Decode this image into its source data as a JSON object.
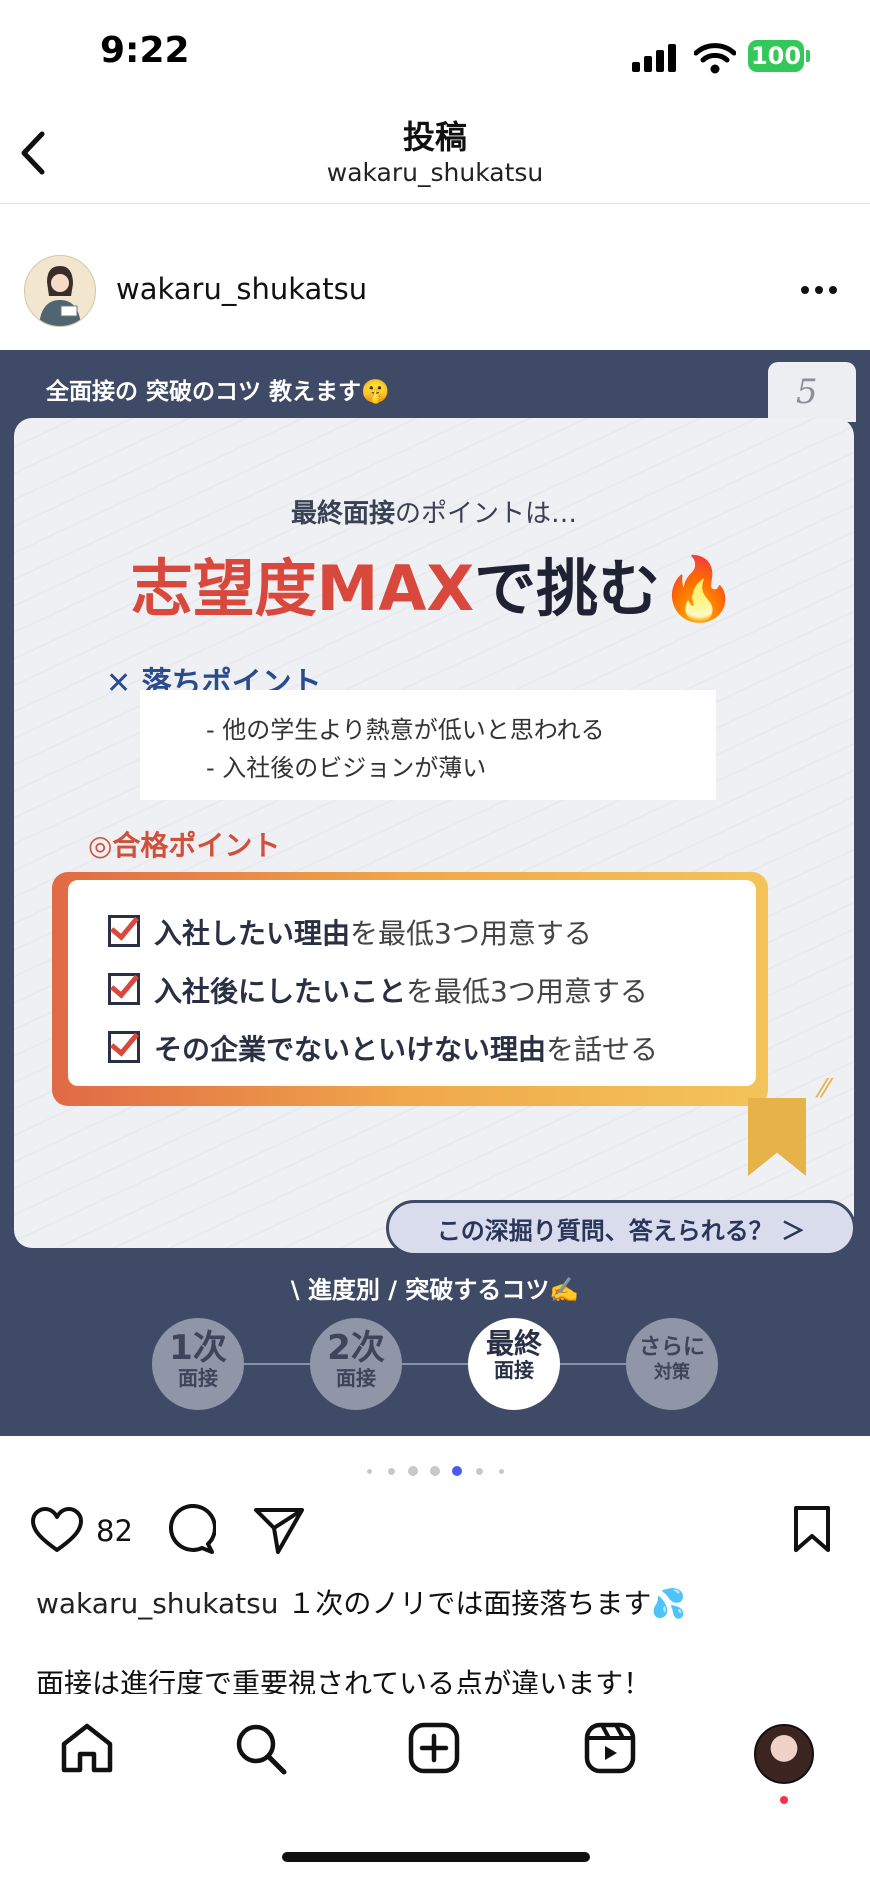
{
  "status_bar": {
    "time": "9:22",
    "battery": "100"
  },
  "header": {
    "title": "投稿",
    "subtitle": "wakaru_shukatsu"
  },
  "post": {
    "username": "wakaru_shukatsu",
    "slide": {
      "tag": "全面接の 突破のコツ 教えます🤫",
      "page_number": "5",
      "lead_bold": "最終面接",
      "lead_rest": "のポイントは…",
      "headline_red": "志望度MAX",
      "headline_dark": "で挑む🔥",
      "fail_heading": "✕ 落ちポイント",
      "fail_items": [
        "- 他の学生より熱意が低いと思われる",
        "- 入社後のビジョンが薄い"
      ],
      "pass_heading": "◎合格ポイント",
      "pass_items": [
        {
          "bold": "入社したい理由",
          "rest": "を最低3つ用意する"
        },
        {
          "bold": "入社後にしたいこと",
          "rest": "を最低3つ用意する"
        },
        {
          "bold": "その企業でないといけない理由",
          "rest": "を話せる"
        }
      ],
      "cta": "この深掘り質問、答えられる？ ＞",
      "stages_title": "\\ 進度別 /  突破するコツ✍️",
      "stages": [
        {
          "top": "1次",
          "bottom": "面接"
        },
        {
          "top": "2次",
          "bottom": "面接"
        },
        {
          "top": "最終",
          "bottom": "面接"
        },
        {
          "top": "さらに",
          "bottom": "対策"
        }
      ],
      "active_stage": 2
    },
    "carousel": {
      "total_dots": 7,
      "active_dot": 4
    },
    "likes": "82",
    "caption_user": "wakaru_shukatsu",
    "caption_text": "１次のノリでは面接落ちます💦",
    "caption_line2": "面接は進行度で重要視されている点が違います！"
  },
  "icons": [
    "back-chevron-icon",
    "more-options-icon",
    "heart-icon",
    "comment-icon",
    "share-icon",
    "bookmark-icon",
    "home-icon",
    "search-icon",
    "create-icon",
    "reels-icon",
    "profile-avatar"
  ]
}
